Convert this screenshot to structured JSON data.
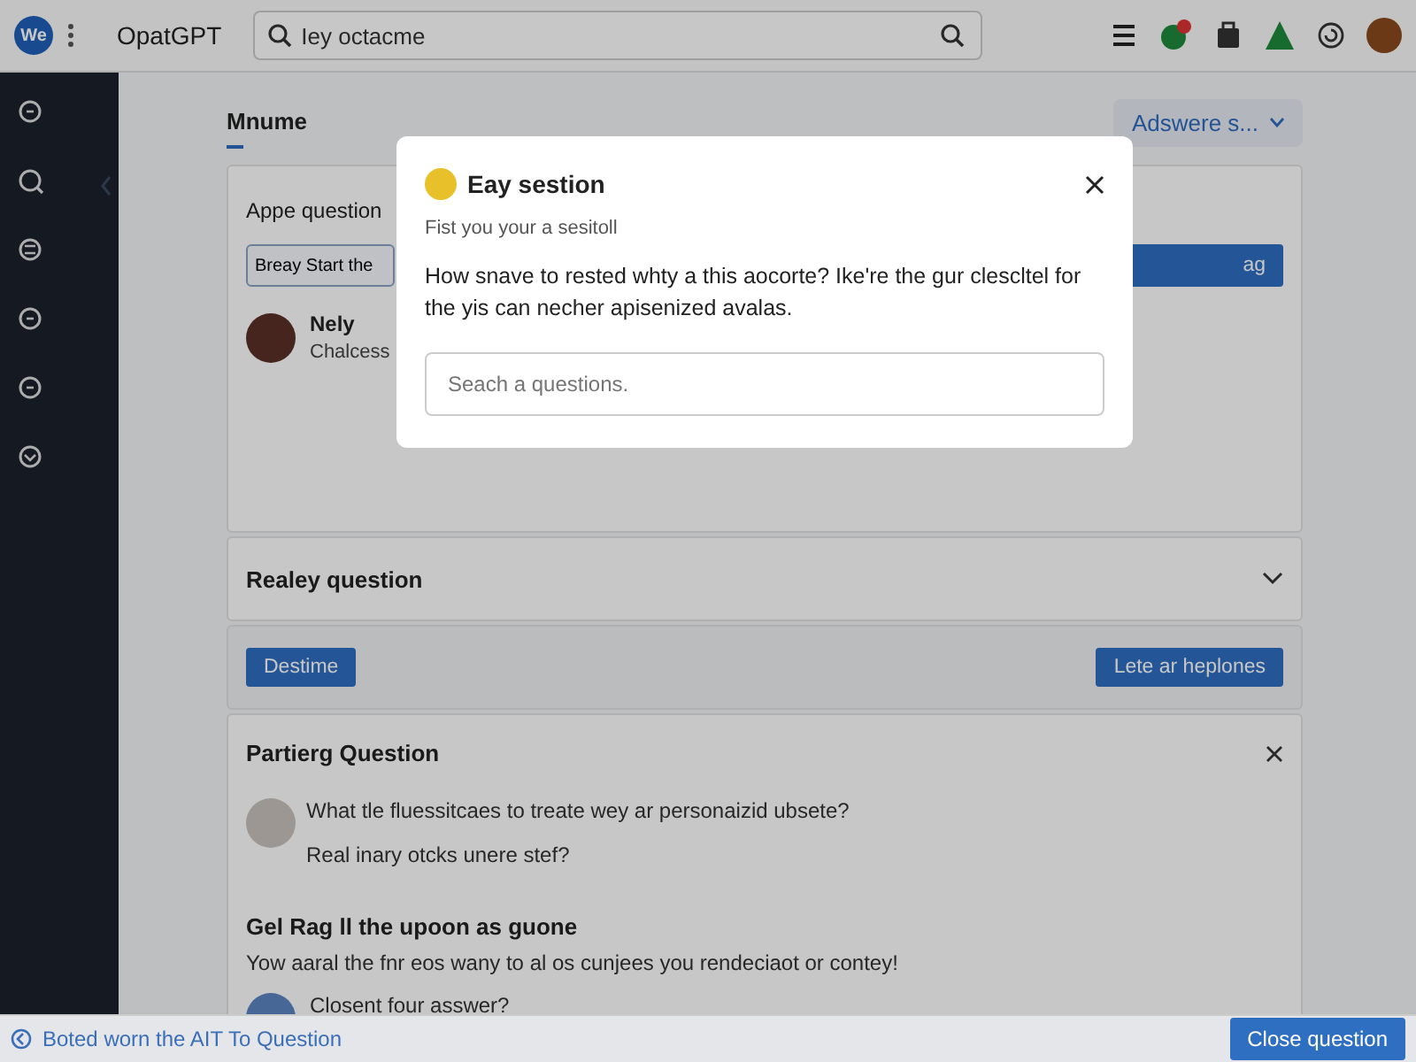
{
  "topbar": {
    "logo": "We",
    "app_name": "OpatGPT",
    "search": {
      "value": "Iey octacme"
    }
  },
  "main": {
    "tab": {
      "label": "Mnume",
      "selected": true
    },
    "dropdown": "Adswere s...",
    "ask_card": {
      "title": "Appe question",
      "input_value": "Breay Start the",
      "button": "ag",
      "user": {
        "name": "Nely",
        "subtitle": "Chalcess"
      }
    },
    "collapsed_section": {
      "title": "Realey question",
      "expanded": false
    },
    "actions": {
      "left_button": "Destime",
      "right_button": "Lete ar heplones"
    },
    "question_card": {
      "title": "Partierg Question",
      "question": "What tle fluessitcaes to treate wey ar personaizid ubsete?",
      "reply": "Real inary otcks unere stef?",
      "heading": "Gel Rag ll the upoon as guone",
      "body": "Yow aaral the fnr eos wany to al os cunjees you rendeciaot or contey!",
      "answer_prompt": "Closent four asswer?"
    }
  },
  "dialog": {
    "title": "Eay sestion",
    "subtitle": "Fist you your a sesitoll",
    "body": "How snave to rested whty a this aocorte? Ike're the gur clescltel for the yis can necher apisenized avalas.",
    "search": {
      "placeholder": "Seach a questions."
    }
  },
  "bottom_bar": {
    "text": "Boted worn the AIT To Question",
    "button": "Close question"
  }
}
